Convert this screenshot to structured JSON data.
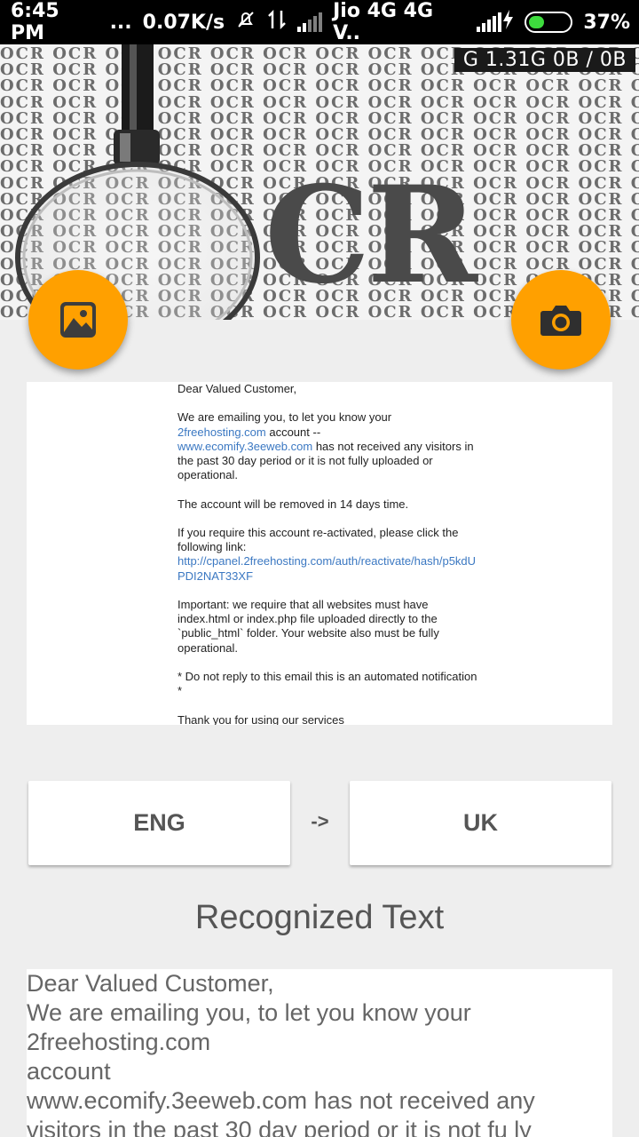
{
  "status_bar": {
    "time": "6:45 PM",
    "dots": "...",
    "speed": "0.07K/s",
    "carrier": "Jio 4G 4G V..",
    "battery_percent": "37%",
    "battery_level": 0.37,
    "icons": [
      "mute-bell-icon",
      "data-transfer-icon",
      "signal-icon",
      "charging-icon",
      "battery-icon"
    ]
  },
  "banner": {
    "background_word": "OCR",
    "big_text": "CR",
    "data_counter": "G 1.31G  0B / 0B"
  },
  "fabs": {
    "gallery_icon": "image-icon",
    "camera_icon": "camera-icon",
    "color": "#ffa000"
  },
  "preview": {
    "greeting": "Dear Valued Customer,",
    "p1_a": "We are emailing you, to let you know your",
    "p1_link1": "2freehosting.com",
    "p1_b": " account --",
    "p1_link2": "www.ecomify.3eeweb.com",
    "p1_c": " has not received any visitors in the past 30 day period or it is not fully uploaded or operational.",
    "p2": "The account will be removed in 14 days time.",
    "p3_a": "If you require this account re-activated, please click the following link:",
    "p3_link": "http://cpanel.2freehosting.com/auth/reactivate/hash/p5kdUPDI2NAT33XF",
    "p4": "Important: we require that all websites must have index.html or index.php file uploaded directly to the `public_html` folder. Your website also must be fully operational.",
    "p5": "* Do not reply to this email this is an automated notification *",
    "p6": "Thank you for using our services"
  },
  "language": {
    "source": "ENG",
    "arrow": "->",
    "target": "UK"
  },
  "heading": "Recognized Text",
  "recognized_lines": [
    "Dear Valued Customer,",
    "We are emailing you, to let you know your",
    "2freehosting.com",
    "account",
    "www.ecomify.3eeweb.com has not received any",
    "visitors in the past 30 day period or it is not fu ly"
  ]
}
